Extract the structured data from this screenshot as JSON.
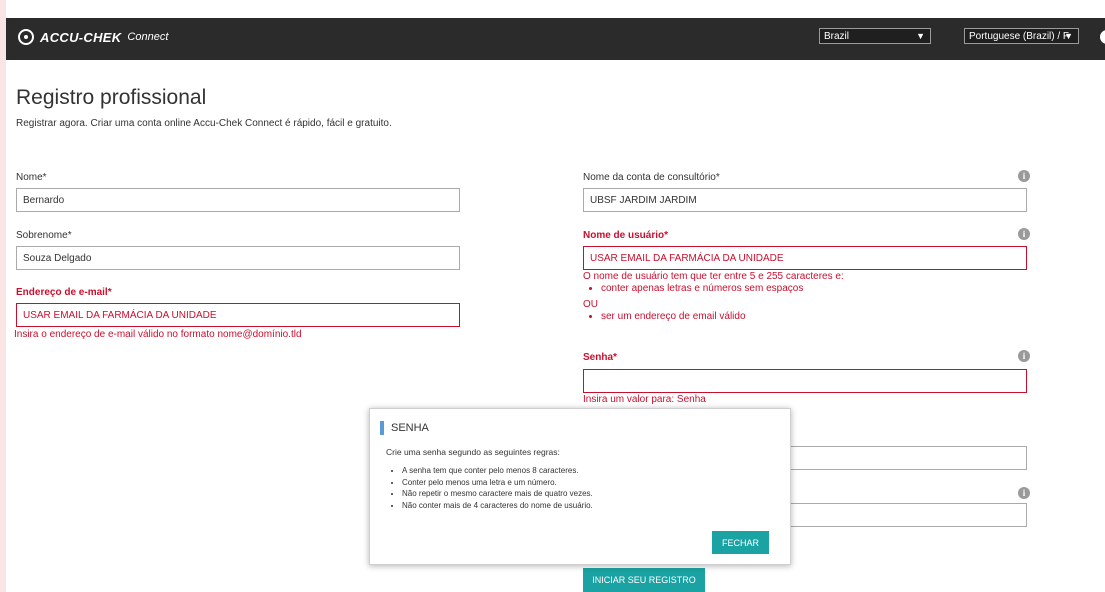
{
  "header": {
    "logo_text": "ACCU-CHEK",
    "logo_sub": "Connect",
    "country": "Brazil",
    "language": "Portuguese (Brazil) / F"
  },
  "page": {
    "title": "Registro profissional",
    "subtitle": "Registrar agora. Criar uma conta online Accu-Chek Connect é rápido, fácil e gratuito."
  },
  "form": {
    "nome": {
      "label": "Nome*",
      "value": "Bernardo"
    },
    "sobrenome": {
      "label": "Sobrenome*",
      "value": "Souza Delgado"
    },
    "email": {
      "label": "Endereço de e-mail*",
      "value": "USAR EMAIL DA FARMÁCIA DA UNIDADE",
      "error": "Insira o endereço de e-mail válido no formato nome@domínio.tld"
    },
    "conta": {
      "label": "Nome da conta de consultório*",
      "value": "UBSF JARDIM JARDIM"
    },
    "usuario": {
      "label": "Nome de usuário*",
      "value": "USAR EMAIL DA FARMÁCIA DA UNIDADE",
      "error_intro": "O nome de usuário tem que ter entre 5 e 255 caracteres e:",
      "rule1": "conter apenas letras e números sem espaços",
      "or": "OU",
      "rule2": "ser um endereço de email válido"
    },
    "senha": {
      "label": "Senha*",
      "value": "",
      "error": "Insira um valor para: Senha"
    },
    "confirm": {
      "value": ""
    },
    "extra": {
      "value": ""
    },
    "info_glyph": "i",
    "submit_label": "INICIAR SEU REGISTRO"
  },
  "popup": {
    "title": "SENHA",
    "intro": "Crie uma senha segundo as seguintes regras:",
    "rules": [
      "A senha tem que conter pelo menos 8 caracteres.",
      "Conter pelo menos uma letra e um número.",
      "Não repetir o mesmo caractere mais de quatro vezes.",
      "Não conter mais de 4 caracteres do nome de usuário."
    ],
    "close_label": "FECHAR"
  },
  "icons": {
    "dropdown": "▼",
    "info": "info-icon",
    "logo": "accu-chek-logo-icon"
  },
  "colors": {
    "header_bg": "#2b2b2b",
    "error": "#c8102e",
    "accent": "#1ba3a3",
    "popup_marker": "#5b9bd5"
  }
}
